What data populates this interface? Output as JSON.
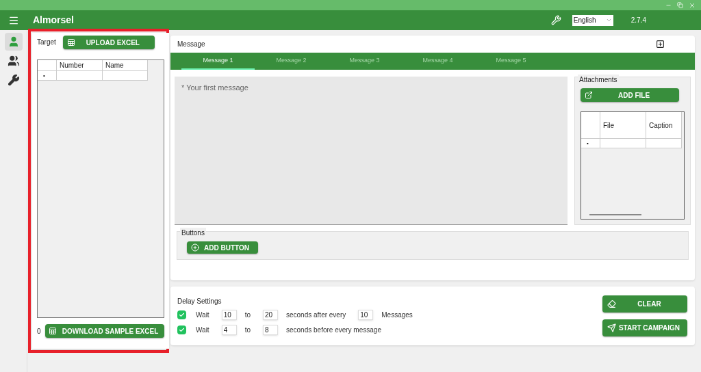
{
  "window": {
    "title": "Almorsel",
    "language": "English",
    "version": "2.7.4"
  },
  "nav": [
    {
      "kind": "person",
      "selected": true
    },
    {
      "kind": "group",
      "selected": false
    },
    {
      "kind": "tools",
      "selected": false
    }
  ],
  "target": {
    "label": "Target",
    "upload_button": "UPLOAD EXCEL",
    "columns": [
      "Number",
      "Name"
    ],
    "new_row_marker": "•",
    "count": "0",
    "download_button": "DOWNLOAD SAMPLE EXCEL"
  },
  "message": {
    "label": "Message",
    "tabs": [
      {
        "label": "Message 1",
        "selected": true
      },
      {
        "label": "Message 2",
        "selected": false
      },
      {
        "label": "Message 3",
        "selected": false
      },
      {
        "label": "Message 4",
        "selected": false
      },
      {
        "label": "Message 5",
        "selected": false
      }
    ],
    "placeholder": "* Your first message",
    "attachments": {
      "label": "Attachments",
      "add_button": "ADD FILE",
      "columns": [
        "File",
        "Caption"
      ],
      "new_row_marker": "•"
    },
    "buttons_section": {
      "label": "Buttons",
      "add_button": "ADD BUTTON"
    }
  },
  "delay": {
    "label": "Delay Settings",
    "rows": [
      {
        "checked": true,
        "parts": [
          {
            "kind": "text",
            "text": "Wait"
          },
          {
            "kind": "field",
            "value": "10"
          },
          {
            "kind": "text",
            "text": "to"
          },
          {
            "kind": "field",
            "value": "20"
          },
          {
            "kind": "text",
            "text": "seconds after every"
          },
          {
            "kind": "field",
            "value": "10"
          },
          {
            "kind": "text",
            "text": "Messages"
          }
        ]
      },
      {
        "checked": true,
        "parts": [
          {
            "kind": "text",
            "text": "Wait"
          },
          {
            "kind": "field",
            "value": "4"
          },
          {
            "kind": "text",
            "text": "to"
          },
          {
            "kind": "field",
            "value": "8"
          },
          {
            "kind": "text",
            "text": "seconds before every message"
          }
        ]
      }
    ]
  },
  "actions": [
    {
      "kind": "clear",
      "label": "CLEAR"
    },
    {
      "kind": "send",
      "label": "START CAMPAIGN"
    }
  ]
}
